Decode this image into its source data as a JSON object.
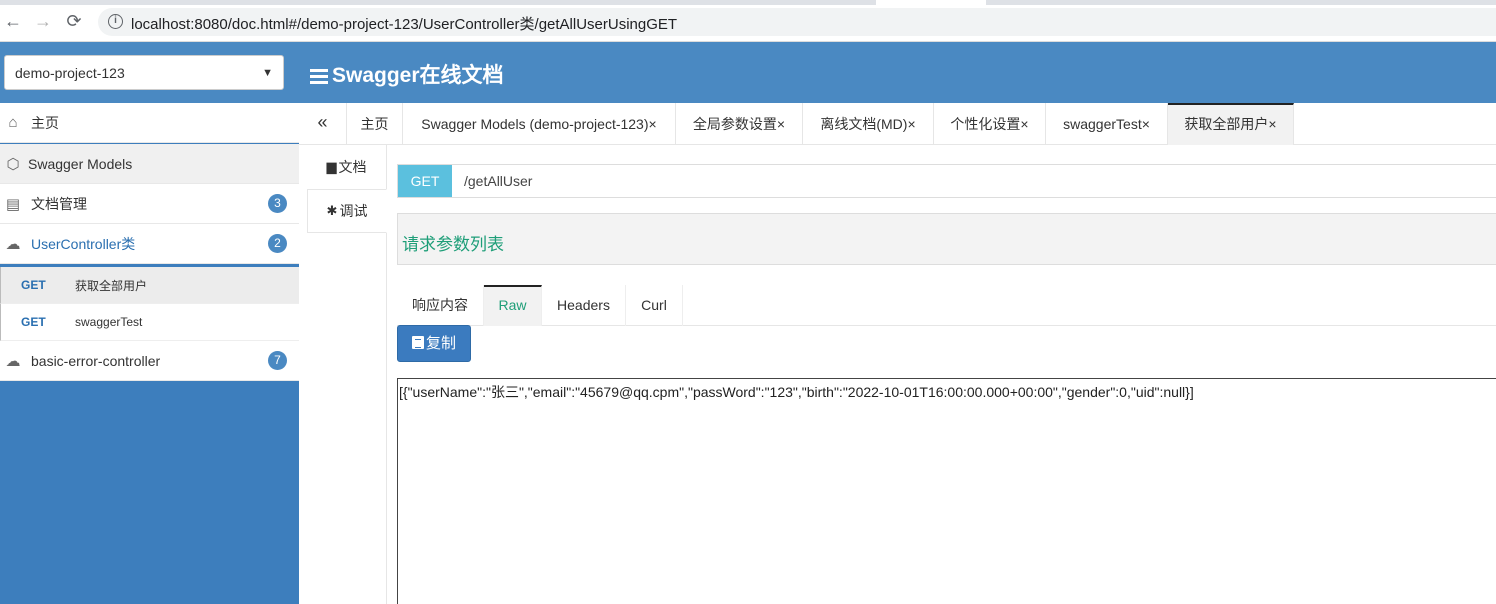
{
  "browser": {
    "url": "localhost:8080/doc.html#/demo-project-123/UserController类/getAllUserUsingGET",
    "back": "←",
    "forward": "→",
    "reload": "C"
  },
  "header": {
    "project_selected": "demo-project-123",
    "title": "Swagger在线文档"
  },
  "sidebar": {
    "items": [
      {
        "label": "主页",
        "icon": "home-icon"
      },
      {
        "label": "Swagger Models",
        "icon": "cube-icon"
      },
      {
        "label": "文档管理",
        "icon": "document-settings-icon",
        "badge": "3"
      },
      {
        "label": "UserController类",
        "icon": "cloud-icon",
        "badge": "2"
      },
      {
        "label": "basic-error-controller",
        "icon": "cloud-icon",
        "badge": "7"
      }
    ],
    "subitems": [
      {
        "method": "GET",
        "name": "获取全部用户"
      },
      {
        "method": "GET",
        "name": "swaggerTest"
      }
    ]
  },
  "tabs": [
    {
      "label": "主页"
    },
    {
      "label": "Swagger Models (demo-project-123)×"
    },
    {
      "label": "全局参数设置×"
    },
    {
      "label": "离线文档(MD)×"
    },
    {
      "label": "个性化设置×"
    },
    {
      "label": "swaggerTest×"
    },
    {
      "label": "获取全部用户×"
    }
  ],
  "collapse_label": "«",
  "vtabs": [
    {
      "label": "文档"
    },
    {
      "label": "调试"
    }
  ],
  "request": {
    "method": "GET",
    "path": "/getAllUser"
  },
  "params_title": "请求参数列表",
  "response_tabs": [
    {
      "label": "响应内容"
    },
    {
      "label": "Raw"
    },
    {
      "label": "Headers"
    },
    {
      "label": "Curl"
    }
  ],
  "copy_label": "复制",
  "raw_response": "[{\"userName\":\"张三\",\"email\":\"45679@qq.cpm\",\"passWord\":\"123\",\"birth\":\"2022-10-01T16:00:00.000+00:00\",\"gender\":0,\"uid\":null}]",
  "colors": {
    "header_bg": "#4a89c2",
    "sidebar_bg": "#3d7ebd",
    "get_badge": "#5bc0de",
    "accent_green": "#1e9e78",
    "copy_button": "#3b7bbf"
  }
}
